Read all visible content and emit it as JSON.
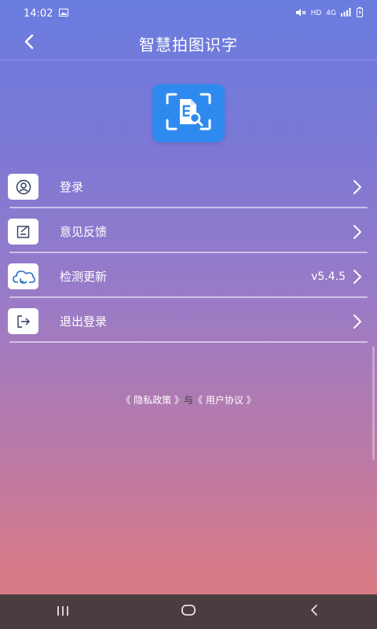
{
  "status_bar": {
    "time": "14:02",
    "indicators": [
      "HD",
      "4G"
    ],
    "icons": [
      "image-icon",
      "mute-icon",
      "signal-icon",
      "battery-icon"
    ]
  },
  "app_bar": {
    "title": "智慧拍图识字",
    "back_icon": "back-arrow-icon"
  },
  "logo": {
    "icon": "document-scan-icon",
    "color": "#2f8af0"
  },
  "menu": {
    "items": [
      {
        "label": "登录",
        "icon": "user-icon",
        "value": ""
      },
      {
        "label": "意见反馈",
        "icon": "feedback-icon",
        "value": ""
      },
      {
        "label": "检测更新",
        "icon": "cloud-refresh-icon",
        "value": "v5.4.5"
      },
      {
        "label": "退出登录",
        "icon": "logout-icon",
        "value": ""
      }
    ]
  },
  "policy": {
    "privacy": "《 隐私政策 》",
    "connector": "与",
    "agreement": "《 用户协议 》"
  },
  "nav_bar": {
    "icons": [
      "recents-icon",
      "home-icon",
      "back-icon"
    ],
    "background": "#4a3c3f"
  }
}
